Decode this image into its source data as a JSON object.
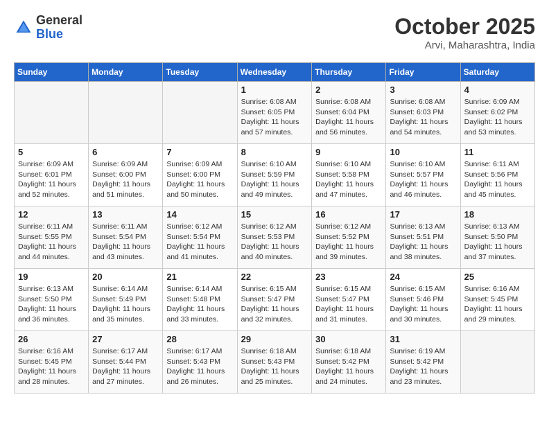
{
  "header": {
    "logo_general": "General",
    "logo_blue": "Blue",
    "title": "October 2025",
    "subtitle": "Arvi, Maharashtra, India"
  },
  "weekdays": [
    "Sunday",
    "Monday",
    "Tuesday",
    "Wednesday",
    "Thursday",
    "Friday",
    "Saturday"
  ],
  "weeks": [
    [
      {
        "day": "",
        "info": ""
      },
      {
        "day": "",
        "info": ""
      },
      {
        "day": "",
        "info": ""
      },
      {
        "day": "1",
        "info": "Sunrise: 6:08 AM\nSunset: 6:05 PM\nDaylight: 11 hours and 57 minutes."
      },
      {
        "day": "2",
        "info": "Sunrise: 6:08 AM\nSunset: 6:04 PM\nDaylight: 11 hours and 56 minutes."
      },
      {
        "day": "3",
        "info": "Sunrise: 6:08 AM\nSunset: 6:03 PM\nDaylight: 11 hours and 54 minutes."
      },
      {
        "day": "4",
        "info": "Sunrise: 6:09 AM\nSunset: 6:02 PM\nDaylight: 11 hours and 53 minutes."
      }
    ],
    [
      {
        "day": "5",
        "info": "Sunrise: 6:09 AM\nSunset: 6:01 PM\nDaylight: 11 hours and 52 minutes."
      },
      {
        "day": "6",
        "info": "Sunrise: 6:09 AM\nSunset: 6:00 PM\nDaylight: 11 hours and 51 minutes."
      },
      {
        "day": "7",
        "info": "Sunrise: 6:09 AM\nSunset: 6:00 PM\nDaylight: 11 hours and 50 minutes."
      },
      {
        "day": "8",
        "info": "Sunrise: 6:10 AM\nSunset: 5:59 PM\nDaylight: 11 hours and 49 minutes."
      },
      {
        "day": "9",
        "info": "Sunrise: 6:10 AM\nSunset: 5:58 PM\nDaylight: 11 hours and 47 minutes."
      },
      {
        "day": "10",
        "info": "Sunrise: 6:10 AM\nSunset: 5:57 PM\nDaylight: 11 hours and 46 minutes."
      },
      {
        "day": "11",
        "info": "Sunrise: 6:11 AM\nSunset: 5:56 PM\nDaylight: 11 hours and 45 minutes."
      }
    ],
    [
      {
        "day": "12",
        "info": "Sunrise: 6:11 AM\nSunset: 5:55 PM\nDaylight: 11 hours and 44 minutes."
      },
      {
        "day": "13",
        "info": "Sunrise: 6:11 AM\nSunset: 5:54 PM\nDaylight: 11 hours and 43 minutes."
      },
      {
        "day": "14",
        "info": "Sunrise: 6:12 AM\nSunset: 5:54 PM\nDaylight: 11 hours and 41 minutes."
      },
      {
        "day": "15",
        "info": "Sunrise: 6:12 AM\nSunset: 5:53 PM\nDaylight: 11 hours and 40 minutes."
      },
      {
        "day": "16",
        "info": "Sunrise: 6:12 AM\nSunset: 5:52 PM\nDaylight: 11 hours and 39 minutes."
      },
      {
        "day": "17",
        "info": "Sunrise: 6:13 AM\nSunset: 5:51 PM\nDaylight: 11 hours and 38 minutes."
      },
      {
        "day": "18",
        "info": "Sunrise: 6:13 AM\nSunset: 5:50 PM\nDaylight: 11 hours and 37 minutes."
      }
    ],
    [
      {
        "day": "19",
        "info": "Sunrise: 6:13 AM\nSunset: 5:50 PM\nDaylight: 11 hours and 36 minutes."
      },
      {
        "day": "20",
        "info": "Sunrise: 6:14 AM\nSunset: 5:49 PM\nDaylight: 11 hours and 35 minutes."
      },
      {
        "day": "21",
        "info": "Sunrise: 6:14 AM\nSunset: 5:48 PM\nDaylight: 11 hours and 33 minutes."
      },
      {
        "day": "22",
        "info": "Sunrise: 6:15 AM\nSunset: 5:47 PM\nDaylight: 11 hours and 32 minutes."
      },
      {
        "day": "23",
        "info": "Sunrise: 6:15 AM\nSunset: 5:47 PM\nDaylight: 11 hours and 31 minutes."
      },
      {
        "day": "24",
        "info": "Sunrise: 6:15 AM\nSunset: 5:46 PM\nDaylight: 11 hours and 30 minutes."
      },
      {
        "day": "25",
        "info": "Sunrise: 6:16 AM\nSunset: 5:45 PM\nDaylight: 11 hours and 29 minutes."
      }
    ],
    [
      {
        "day": "26",
        "info": "Sunrise: 6:16 AM\nSunset: 5:45 PM\nDaylight: 11 hours and 28 minutes."
      },
      {
        "day": "27",
        "info": "Sunrise: 6:17 AM\nSunset: 5:44 PM\nDaylight: 11 hours and 27 minutes."
      },
      {
        "day": "28",
        "info": "Sunrise: 6:17 AM\nSunset: 5:43 PM\nDaylight: 11 hours and 26 minutes."
      },
      {
        "day": "29",
        "info": "Sunrise: 6:18 AM\nSunset: 5:43 PM\nDaylight: 11 hours and 25 minutes."
      },
      {
        "day": "30",
        "info": "Sunrise: 6:18 AM\nSunset: 5:42 PM\nDaylight: 11 hours and 24 minutes."
      },
      {
        "day": "31",
        "info": "Sunrise: 6:19 AM\nSunset: 5:42 PM\nDaylight: 11 hours and 23 minutes."
      },
      {
        "day": "",
        "info": ""
      }
    ]
  ]
}
